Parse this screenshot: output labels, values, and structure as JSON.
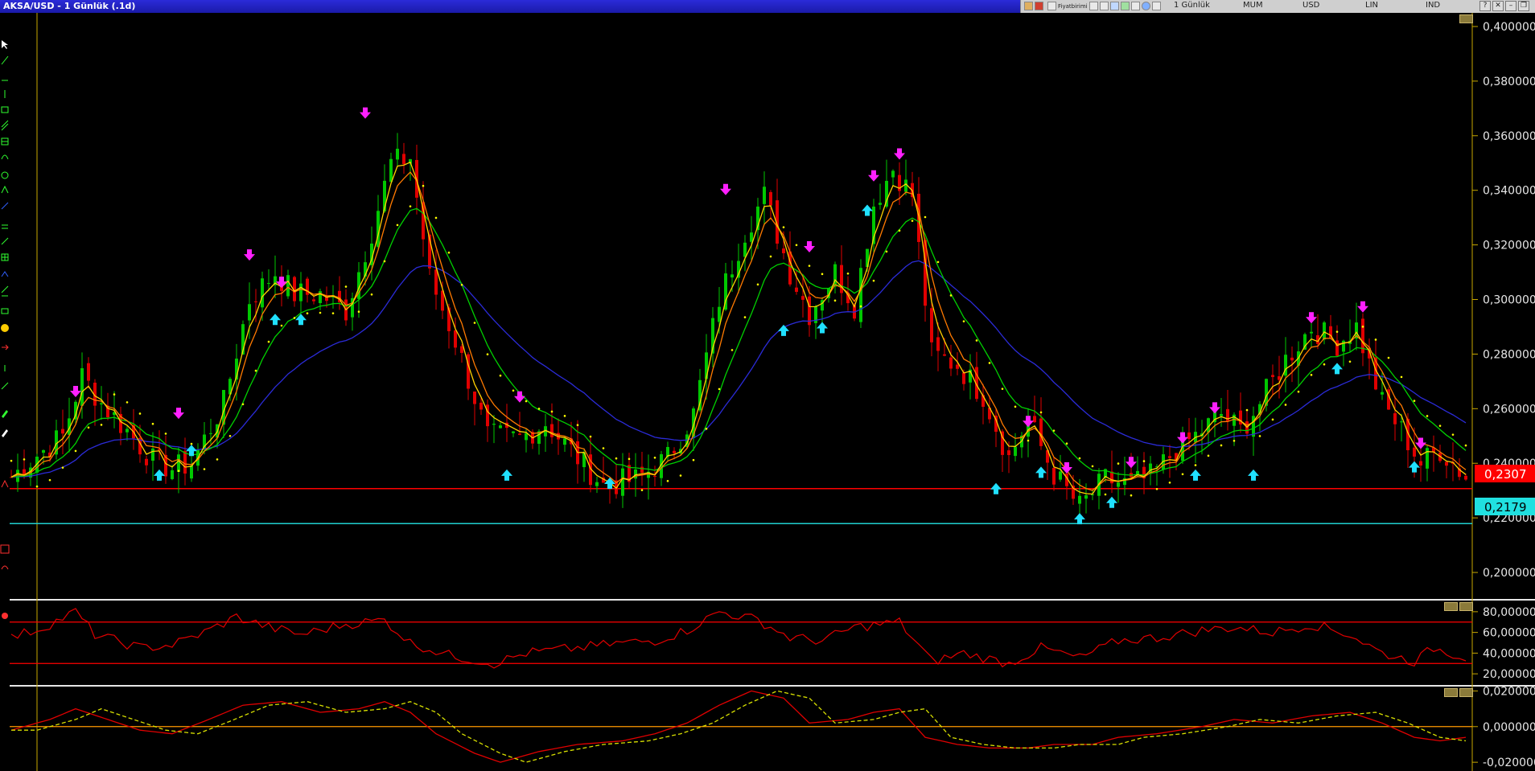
{
  "window": {
    "title": "AKSA/USD - 1 Günlük (.1d)"
  },
  "toolbar": {
    "items": [
      {
        "kind": "icon",
        "name": "color-icon"
      },
      {
        "kind": "icon",
        "name": "palette-icon"
      },
      {
        "kind": "icon",
        "name": "page-icon"
      },
      {
        "kind": "text",
        "label": "Fiyatbirimi"
      },
      {
        "kind": "icon",
        "name": "table-icon"
      },
      {
        "kind": "icon",
        "name": "grid-icon"
      },
      {
        "kind": "icon",
        "name": "chart-icon"
      },
      {
        "kind": "icon",
        "name": "pen-icon"
      },
      {
        "kind": "icon",
        "name": "link-icon"
      },
      {
        "kind": "icon",
        "name": "globe-icon"
      },
      {
        "kind": "icon",
        "name": "indicator-icon"
      }
    ],
    "period": "1 Günlük",
    "chart_type": "MUM",
    "currency": "USD",
    "scale": "LIN",
    "indicator": "IND"
  },
  "price_panel": {
    "y_ticks": [
      "0,400000",
      "0,380000",
      "0,360000",
      "0,340000",
      "0,320000",
      "0,300000",
      "0,280000",
      "0,260000",
      "0,240000",
      "0,220000",
      "0,200000"
    ],
    "red_line_label": "0,2307",
    "cyan_line_label": "0,2179"
  },
  "rsi_panel": {
    "y_ticks": [
      "80,000000",
      "60,000000",
      "40,000000",
      "20,000000"
    ]
  },
  "macd_panel": {
    "y_ticks": [
      "0,020000",
      "0,000000",
      "-0,020000"
    ]
  },
  "colors": {
    "up_candle": "#00c800",
    "down_candle": "#e00000",
    "ma_fast": "#ffd000",
    "ma_fast2": "#ff7a00",
    "ma_mid": "#00d000",
    "ma_long": "#2b2bd8",
    "sar": "#ffff00",
    "sell_arrow": "#ff20ff",
    "buy_arrow": "#20e0ff",
    "support_red": "#ff0000",
    "support_cyan": "#20d0d0",
    "axis": "#c8a800"
  },
  "chart_data": {
    "type": "candlestick",
    "y_range": [
      0.19,
      0.405
    ],
    "horizontal_levels": [
      0.2307,
      0.2179
    ],
    "close_anchors": [
      [
        0,
        0.235
      ],
      [
        4,
        0.243
      ],
      [
        8,
        0.25
      ],
      [
        11,
        0.272
      ],
      [
        14,
        0.262
      ],
      [
        18,
        0.252
      ],
      [
        22,
        0.241
      ],
      [
        25,
        0.238
      ],
      [
        28,
        0.24
      ],
      [
        33,
        0.262
      ],
      [
        37,
        0.3
      ],
      [
        41,
        0.31
      ],
      [
        44,
        0.302
      ],
      [
        48,
        0.302
      ],
      [
        52,
        0.296
      ],
      [
        56,
        0.325
      ],
      [
        59,
        0.35
      ],
      [
        62,
        0.352
      ],
      [
        65,
        0.308
      ],
      [
        69,
        0.285
      ],
      [
        74,
        0.25
      ],
      [
        79,
        0.249
      ],
      [
        83,
        0.255
      ],
      [
        88,
        0.242
      ],
      [
        92,
        0.232
      ],
      [
        97,
        0.234
      ],
      [
        102,
        0.242
      ],
      [
        106,
        0.258
      ],
      [
        110,
        0.3
      ],
      [
        114,
        0.325
      ],
      [
        117,
        0.338
      ],
      [
        121,
        0.31
      ],
      [
        124,
        0.295
      ],
      [
        128,
        0.31
      ],
      [
        131,
        0.298
      ],
      [
        134,
        0.335
      ],
      [
        137,
        0.348
      ],
      [
        140,
        0.338
      ],
      [
        143,
        0.28
      ],
      [
        147,
        0.276
      ],
      [
        151,
        0.265
      ],
      [
        155,
        0.242
      ],
      [
        158,
        0.256
      ],
      [
        162,
        0.236
      ],
      [
        166,
        0.224
      ],
      [
        170,
        0.234
      ],
      [
        174,
        0.232
      ],
      [
        177,
        0.235
      ],
      [
        181,
        0.245
      ],
      [
        184,
        0.25
      ],
      [
        188,
        0.258
      ],
      [
        191,
        0.252
      ],
      [
        194,
        0.262
      ],
      [
        198,
        0.278
      ],
      [
        202,
        0.29
      ],
      [
        206,
        0.284
      ],
      [
        209,
        0.29
      ],
      [
        213,
        0.262
      ],
      [
        216,
        0.252
      ],
      [
        219,
        0.24
      ],
      [
        222,
        0.245
      ],
      [
        226,
        0.235
      ]
    ],
    "sell_signals": [
      [
        10,
        0.266
      ],
      [
        26,
        0.258
      ],
      [
        37,
        0.316
      ],
      [
        42,
        0.306
      ],
      [
        55,
        0.368
      ],
      [
        79,
        0.264
      ],
      [
        111,
        0.34
      ],
      [
        124,
        0.319
      ],
      [
        134,
        0.345
      ],
      [
        138,
        0.353
      ],
      [
        158,
        0.255
      ],
      [
        164,
        0.238
      ],
      [
        174,
        0.24
      ],
      [
        182,
        0.249
      ],
      [
        187,
        0.26
      ],
      [
        202,
        0.293
      ],
      [
        210,
        0.297
      ],
      [
        219,
        0.247
      ]
    ],
    "buy_signals": [
      [
        23,
        0.236
      ],
      [
        28,
        0.245
      ],
      [
        41,
        0.293
      ],
      [
        45,
        0.293
      ],
      [
        77,
        0.236
      ],
      [
        93,
        0.233
      ],
      [
        120,
        0.289
      ],
      [
        126,
        0.29
      ],
      [
        133,
        0.333
      ],
      [
        153,
        0.231
      ],
      [
        160,
        0.237
      ],
      [
        166,
        0.22
      ],
      [
        171,
        0.226
      ],
      [
        184,
        0.236
      ],
      [
        193,
        0.236
      ],
      [
        206,
        0.275
      ],
      [
        218,
        0.239
      ]
    ],
    "rsi": {
      "range": [
        10,
        90
      ],
      "levels": [
        70,
        30
      ],
      "anchors": [
        [
          0,
          55
        ],
        [
          5,
          65
        ],
        [
          10,
          80
        ],
        [
          13,
          58
        ],
        [
          20,
          45
        ],
        [
          25,
          48
        ],
        [
          30,
          60
        ],
        [
          35,
          75
        ],
        [
          40,
          65
        ],
        [
          45,
          58
        ],
        [
          52,
          68
        ],
        [
          58,
          72
        ],
        [
          62,
          50
        ],
        [
          68,
          38
        ],
        [
          75,
          30
        ],
        [
          80,
          40
        ],
        [
          88,
          45
        ],
        [
          95,
          50
        ],
        [
          100,
          52
        ],
        [
          105,
          62
        ],
        [
          110,
          80
        ],
        [
          116,
          72
        ],
        [
          121,
          55
        ],
        [
          126,
          52
        ],
        [
          131,
          65
        ],
        [
          138,
          70
        ],
        [
          143,
          32
        ],
        [
          148,
          40
        ],
        [
          155,
          30
        ],
        [
          160,
          45
        ],
        [
          166,
          35
        ],
        [
          172,
          52
        ],
        [
          178,
          55
        ],
        [
          185,
          62
        ],
        [
          190,
          65
        ],
        [
          196,
          60
        ],
        [
          202,
          68
        ],
        [
          208,
          58
        ],
        [
          213,
          40
        ],
        [
          218,
          32
        ],
        [
          221,
          45
        ],
        [
          226,
          36
        ]
      ]
    },
    "macd": {
      "range": [
        -0.024,
        0.022
      ],
      "signal_lag": 4,
      "anchors": [
        [
          0,
          -0.002
        ],
        [
          6,
          0.004
        ],
        [
          10,
          0.01
        ],
        [
          15,
          0.004
        ],
        [
          20,
          -0.002
        ],
        [
          25,
          -0.004
        ],
        [
          30,
          0.003
        ],
        [
          36,
          0.012
        ],
        [
          42,
          0.014
        ],
        [
          48,
          0.008
        ],
        [
          54,
          0.01
        ],
        [
          58,
          0.014
        ],
        [
          62,
          0.008
        ],
        [
          66,
          -0.004
        ],
        [
          72,
          -0.015
        ],
        [
          76,
          -0.02
        ],
        [
          82,
          -0.014
        ],
        [
          88,
          -0.01
        ],
        [
          95,
          -0.008
        ],
        [
          100,
          -0.004
        ],
        [
          105,
          0.002
        ],
        [
          110,
          0.012
        ],
        [
          115,
          0.02
        ],
        [
          120,
          0.016
        ],
        [
          124,
          0.002
        ],
        [
          130,
          0.004
        ],
        [
          134,
          0.008
        ],
        [
          138,
          0.01
        ],
        [
          142,
          -0.006
        ],
        [
          147,
          -0.01
        ],
        [
          152,
          -0.012
        ],
        [
          158,
          -0.012
        ],
        [
          162,
          -0.01
        ],
        [
          168,
          -0.01
        ],
        [
          172,
          -0.006
        ],
        [
          178,
          -0.004
        ],
        [
          185,
          0.0
        ],
        [
          190,
          0.004
        ],
        [
          196,
          0.002
        ],
        [
          202,
          0.006
        ],
        [
          208,
          0.008
        ],
        [
          213,
          0.002
        ],
        [
          218,
          -0.006
        ],
        [
          222,
          -0.008
        ],
        [
          226,
          -0.006
        ]
      ]
    }
  }
}
